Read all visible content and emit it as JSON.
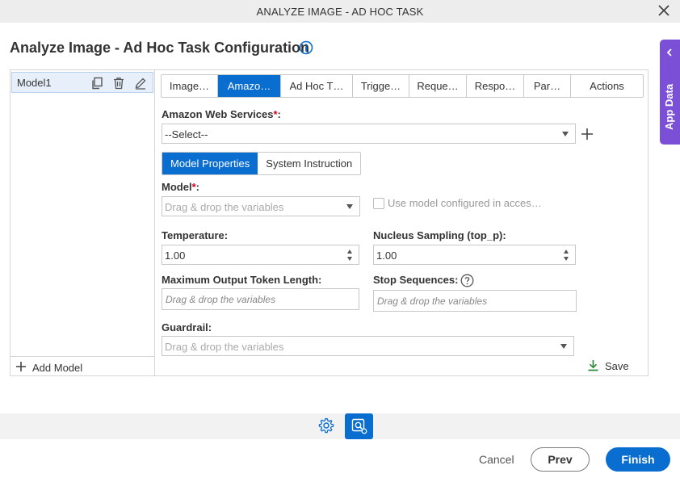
{
  "window": {
    "title": "ANALYZE IMAGE - AD HOC TASK"
  },
  "page": {
    "heading": "Analyze Image - Ad Hoc Task Configuration"
  },
  "app_data": {
    "label": "App Data"
  },
  "models": {
    "items": [
      {
        "name": "Model1"
      }
    ],
    "add_label": "Add Model"
  },
  "tabs": [
    {
      "label": "Image…",
      "active": false
    },
    {
      "label": "Amazo…",
      "active": true
    },
    {
      "label": "Ad Hoc T…",
      "active": false
    },
    {
      "label": "Trigge…",
      "active": false
    },
    {
      "label": "Reque…",
      "active": false
    },
    {
      "label": "Respo…",
      "active": false
    },
    {
      "label": "Par…",
      "active": false
    },
    {
      "label": "Actions",
      "active": false
    }
  ],
  "aws": {
    "label": "Amazon Web Services",
    "required_mark": "*",
    "colon": ":",
    "value": "--Select--"
  },
  "subtabs": [
    {
      "label": "Model Properties",
      "active": true
    },
    {
      "label": "System Instruction",
      "active": false
    }
  ],
  "form": {
    "model": {
      "label": "Model",
      "required_mark": "*",
      "colon": ":",
      "placeholder": "Drag & drop the variables"
    },
    "use_model": {
      "label": "Use model configured in acces…",
      "checked": false
    },
    "temperature": {
      "label": "Temperature:",
      "value": "1.00"
    },
    "top_p": {
      "label": "Nucleus Sampling (top_p):",
      "value": "1.00"
    },
    "max_tokens": {
      "label": "Maximum Output Token Length:",
      "placeholder": "Drag & drop the variables"
    },
    "stop_sequences": {
      "label": "Stop Sequences:",
      "placeholder": "Drag & drop the variables"
    },
    "guardrail": {
      "label": "Guardrail:",
      "placeholder": "Drag & drop the variables"
    }
  },
  "save_label": "Save",
  "footer": {
    "cancel": "Cancel",
    "prev": "Prev",
    "finish": "Finish"
  },
  "colors": {
    "accent": "#0a6ed1",
    "app_data_tab": "#7b4fd6",
    "save_icon": "#2e8b3e",
    "required": "#d0021b"
  }
}
